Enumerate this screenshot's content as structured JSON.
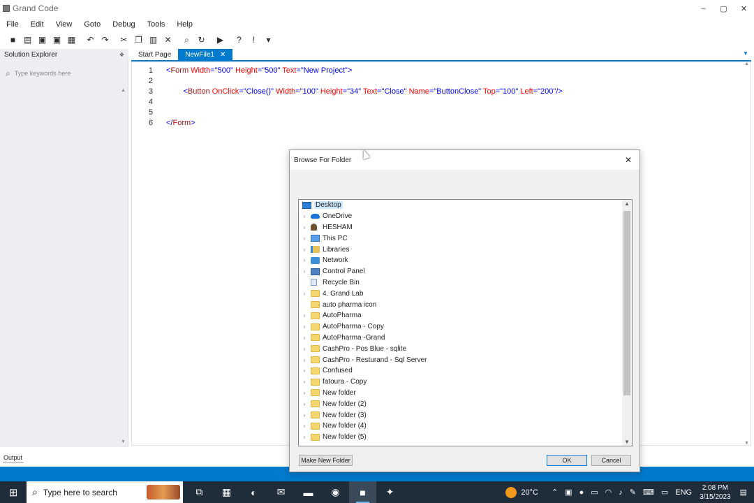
{
  "window": {
    "title": "Grand Code",
    "minimize": "–",
    "maximize": "▢",
    "close": "✕"
  },
  "menu": [
    "File",
    "Edit",
    "View",
    "Goto",
    "Debug",
    "Tools",
    "Help"
  ],
  "toolbar": {
    "icons": [
      "new-file-icon",
      "open-folder-icon",
      "save-icon",
      "save-all-icon",
      "print-icon",
      "undo-icon",
      "redo-icon",
      "cut-icon",
      "copy-icon",
      "paste-icon",
      "delete-icon",
      "find-icon",
      "refresh-icon",
      "run-icon",
      "help-icon",
      "info-icon",
      "dropdown-icon"
    ],
    "glyphs": [
      "■",
      "▤",
      "▣",
      "▣",
      "▦",
      "↶",
      "↷",
      "✂",
      "❐",
      "▥",
      "✕",
      "⌕",
      "↻",
      "▶",
      "?",
      "!",
      "▾"
    ]
  },
  "solution_explorer": {
    "title": "Solution Explorer",
    "pin": "❖",
    "search_placeholder": "Type keywords here"
  },
  "tabs": [
    {
      "label": "Start Page",
      "active": false
    },
    {
      "label": "NewFile1",
      "active": true,
      "close": "✕"
    }
  ],
  "editor": {
    "lines": [
      {
        "num": "1",
        "indent": "",
        "tokens": [
          [
            "b",
            "<"
          ],
          [
            "t",
            "Form"
          ],
          [
            "a",
            " Width"
          ],
          [
            "b",
            "="
          ],
          [
            "v",
            "\"500\""
          ],
          [
            "a",
            " Height"
          ],
          [
            "b",
            "="
          ],
          [
            "v",
            "\"500\""
          ],
          [
            "a",
            " Text"
          ],
          [
            "b",
            "="
          ],
          [
            "v",
            "\"New Project\""
          ],
          [
            "b",
            ">"
          ]
        ]
      },
      {
        "num": "2",
        "indent": "",
        "tokens": []
      },
      {
        "num": "3",
        "indent": "        ",
        "tokens": [
          [
            "b",
            "<"
          ],
          [
            "t",
            "Button"
          ],
          [
            "a",
            " OnClick"
          ],
          [
            "b",
            "="
          ],
          [
            "v",
            "\"Close()\""
          ],
          [
            "a",
            " Width"
          ],
          [
            "b",
            "="
          ],
          [
            "v",
            "\"100\""
          ],
          [
            "a",
            " Height"
          ],
          [
            "b",
            "="
          ],
          [
            "v",
            "\"34\""
          ],
          [
            "a",
            " Text"
          ],
          [
            "b",
            "="
          ],
          [
            "v",
            "\"Close\""
          ],
          [
            "a",
            " Name"
          ],
          [
            "b",
            "="
          ],
          [
            "v",
            "\"ButtonClose\""
          ],
          [
            "a",
            " Top"
          ],
          [
            "b",
            "="
          ],
          [
            "v",
            "\"100\""
          ],
          [
            "a",
            " Left"
          ],
          [
            "b",
            "="
          ],
          [
            "v",
            "\"200\""
          ],
          [
            "b",
            "/>"
          ]
        ]
      },
      {
        "num": "4",
        "indent": "",
        "tokens": []
      },
      {
        "num": "5",
        "indent": "",
        "tokens": []
      },
      {
        "num": "6",
        "indent": "",
        "tokens": [
          [
            "b",
            "</"
          ],
          [
            "t",
            "Form"
          ],
          [
            "b",
            ">"
          ]
        ]
      }
    ]
  },
  "output": {
    "label": "Output"
  },
  "dialog": {
    "title": "Browse For Folder",
    "close": "✕",
    "tree": [
      {
        "label": "Desktop",
        "icon": "desktop",
        "expander": "",
        "selected": true,
        "level": 0
      },
      {
        "label": "OneDrive",
        "icon": "onedrive",
        "expander": "›",
        "level": 1
      },
      {
        "label": "HESHAM",
        "icon": "user",
        "expander": "›",
        "level": 1
      },
      {
        "label": "This PC",
        "icon": "pc",
        "expander": "›",
        "level": 1
      },
      {
        "label": "Libraries",
        "icon": "libraries",
        "expander": "›",
        "level": 1
      },
      {
        "label": "Network",
        "icon": "network",
        "expander": "›",
        "level": 1
      },
      {
        "label": "Control Panel",
        "icon": "control",
        "expander": "›",
        "level": 1
      },
      {
        "label": "Recycle Bin",
        "icon": "recycle",
        "expander": "",
        "level": 1
      },
      {
        "label": "4. Grand Lab",
        "icon": "folder",
        "expander": "›",
        "level": 1
      },
      {
        "label": "auto pharma icon",
        "icon": "folder",
        "expander": "",
        "level": 1
      },
      {
        "label": "AutoPharma",
        "icon": "folder",
        "expander": "›",
        "level": 1
      },
      {
        "label": "AutoPharma - Copy",
        "icon": "folder",
        "expander": "›",
        "level": 1
      },
      {
        "label": "AutoPharma -Grand",
        "icon": "folder",
        "expander": "›",
        "level": 1
      },
      {
        "label": "CashPro - Pos Blue - sqlite",
        "icon": "folder",
        "expander": "›",
        "level": 1
      },
      {
        "label": "CashPro - Resturand - Sql Server",
        "icon": "folder",
        "expander": "›",
        "level": 1
      },
      {
        "label": "Confused",
        "icon": "folder",
        "expander": "›",
        "level": 1
      },
      {
        "label": "fatoura - Copy",
        "icon": "folder",
        "expander": "›",
        "level": 1
      },
      {
        "label": "New folder",
        "icon": "folder",
        "expander": "›",
        "level": 1
      },
      {
        "label": "New folder (2)",
        "icon": "folder",
        "expander": "›",
        "level": 1
      },
      {
        "label": "New folder (3)",
        "icon": "folder",
        "expander": "›",
        "level": 1
      },
      {
        "label": "New folder (4)",
        "icon": "folder",
        "expander": "›",
        "level": 1
      },
      {
        "label": "New folder (5)",
        "icon": "folder",
        "expander": "›",
        "level": 1
      }
    ],
    "make_new_folder": "Make New Folder",
    "ok": "OK",
    "cancel": "Cancel"
  },
  "taskbar": {
    "search_placeholder": "Type here to search",
    "apps": [
      {
        "name": "task-view-icon",
        "glyph": "⧉",
        "active": false
      },
      {
        "name": "microsoft-store-icon",
        "glyph": "▦",
        "active": false
      },
      {
        "name": "edge-icon",
        "glyph": "◐",
        "active": false
      },
      {
        "name": "mail-icon",
        "glyph": "✉",
        "active": false
      },
      {
        "name": "file-explorer-icon",
        "glyph": "▬",
        "active": false
      },
      {
        "name": "chrome-icon",
        "glyph": "◉",
        "active": false
      },
      {
        "name": "grand-code-icon",
        "glyph": "■",
        "active": true
      },
      {
        "name": "app-icon",
        "glyph": "✦",
        "active": false
      }
    ],
    "weather": "20°C",
    "language": "ENG",
    "time": "2:08 PM",
    "date": "3/15/2023"
  },
  "colors": {
    "accent": "#007acc",
    "taskbar": "#1f2c3a",
    "tag": "#a31515",
    "attr": "#ff0000",
    "value": "#0000ff"
  }
}
